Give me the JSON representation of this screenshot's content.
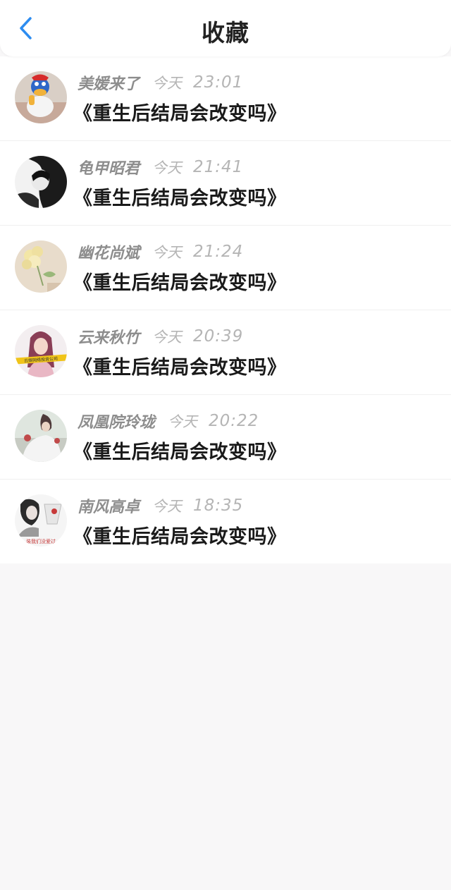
{
  "header": {
    "title": "收藏",
    "back_icon": "chevron-left-icon",
    "back_color": "#2d8cf0"
  },
  "favorites": [
    {
      "author": "美媛来了",
      "day": "今天",
      "time": "23:01",
      "title": "《重生后结局会改变吗》"
    },
    {
      "author": "龟甲昭君",
      "day": "今天",
      "time": "21:41",
      "title": "《重生后结局会改变吗》"
    },
    {
      "author": "幽花尚斌",
      "day": "今天",
      "time": "21:24",
      "title": "《重生后结局会改变吗》"
    },
    {
      "author": "云来秋竹",
      "day": "今天",
      "time": "20:39",
      "title": "《重生后结局会改变吗》"
    },
    {
      "author": "凤凰院玲珑",
      "day": "今天",
      "time": "20:22",
      "title": "《重生后结局会改变吗》"
    },
    {
      "author": "南风高卓",
      "day": "今天",
      "time": "18:35",
      "title": "《重生后结局会改变吗》"
    }
  ],
  "avatar_banners": {
    "row3": "云娱网络投资公司",
    "row5": "装我们没爱过"
  }
}
